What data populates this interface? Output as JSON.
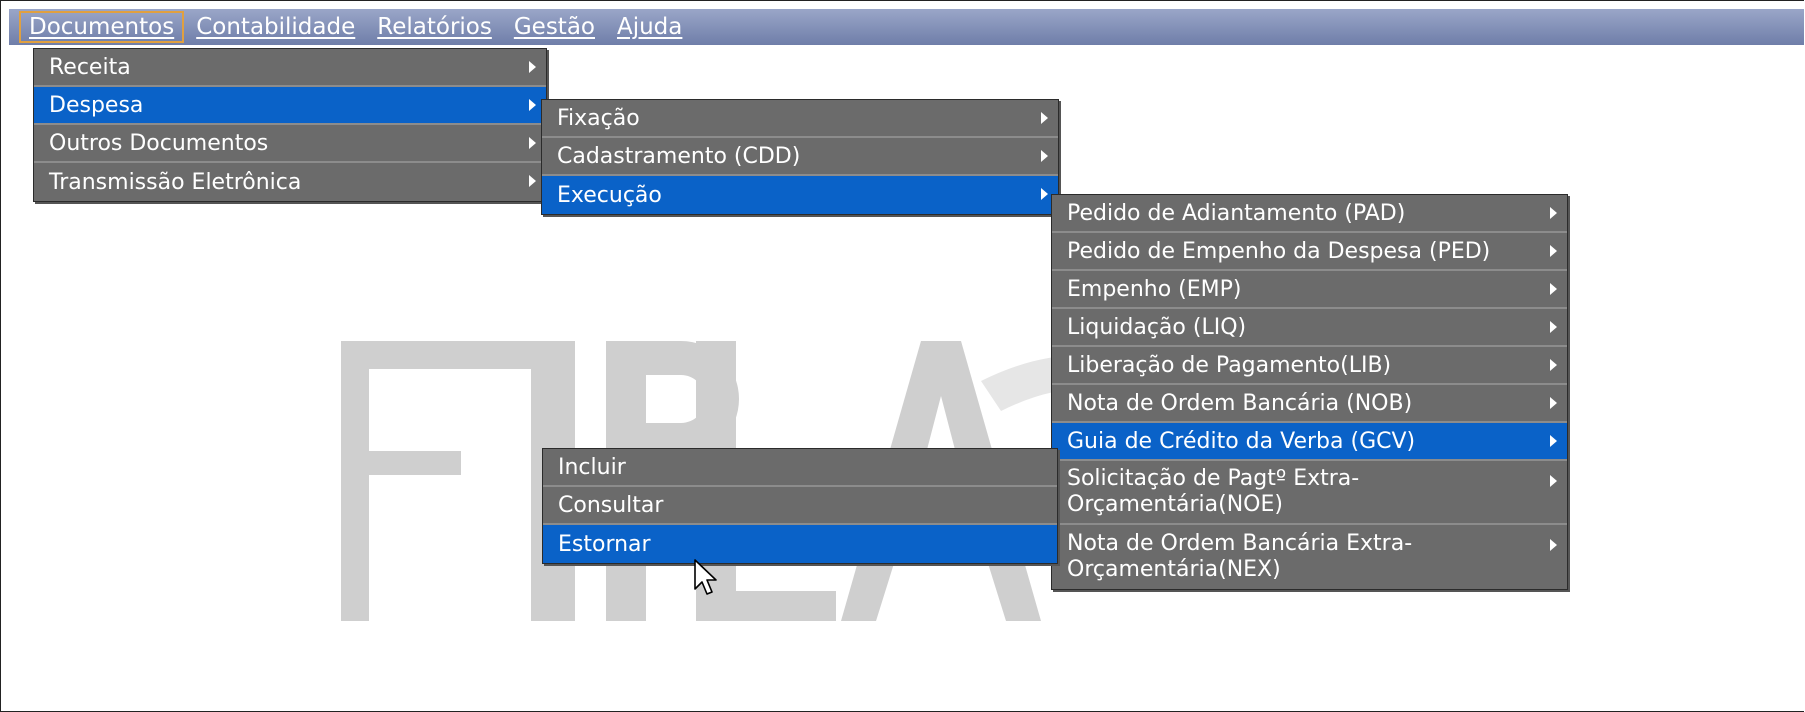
{
  "menubar": {
    "items": [
      "Documentos",
      "Contabilidade",
      "Relatórios",
      "Gestão",
      "Ajuda"
    ]
  },
  "menus": {
    "documentos": [
      "Receita",
      "Despesa",
      "Outros Documentos",
      "Transmissão Eletrônica"
    ],
    "despesa": [
      "Fixação",
      "Cadastramento (CDD)",
      "Execução"
    ],
    "execucao": [
      "Pedido de Adiantamento (PAD)",
      "Pedido de Empenho da Despesa (PED)",
      "Empenho (EMP)",
      "Liquidação (LIQ)",
      "Liberação de Pagamento(LIB)",
      "Nota de Ordem Bancária (NOB)",
      "Guia de Crédito da Verba (GCV)",
      "Solicitação de Pagtº Extra-Orçamentária(NOE)",
      "Nota de Ordem Bancária Extra-Orçamentária(NEX)"
    ],
    "gcv": [
      "Incluir",
      "Consultar",
      "Estornar"
    ]
  },
  "watermark": {
    "text": "FIPLAN",
    "color": "#cfcfcf"
  },
  "colors": {
    "menubar": "#8090b8",
    "menu_bg": "#6b6b6b",
    "selection": "#0a62c8"
  },
  "icons": {
    "submenu": "submenu-arrow-icon",
    "pointer": "mouse-pointer-icon"
  }
}
